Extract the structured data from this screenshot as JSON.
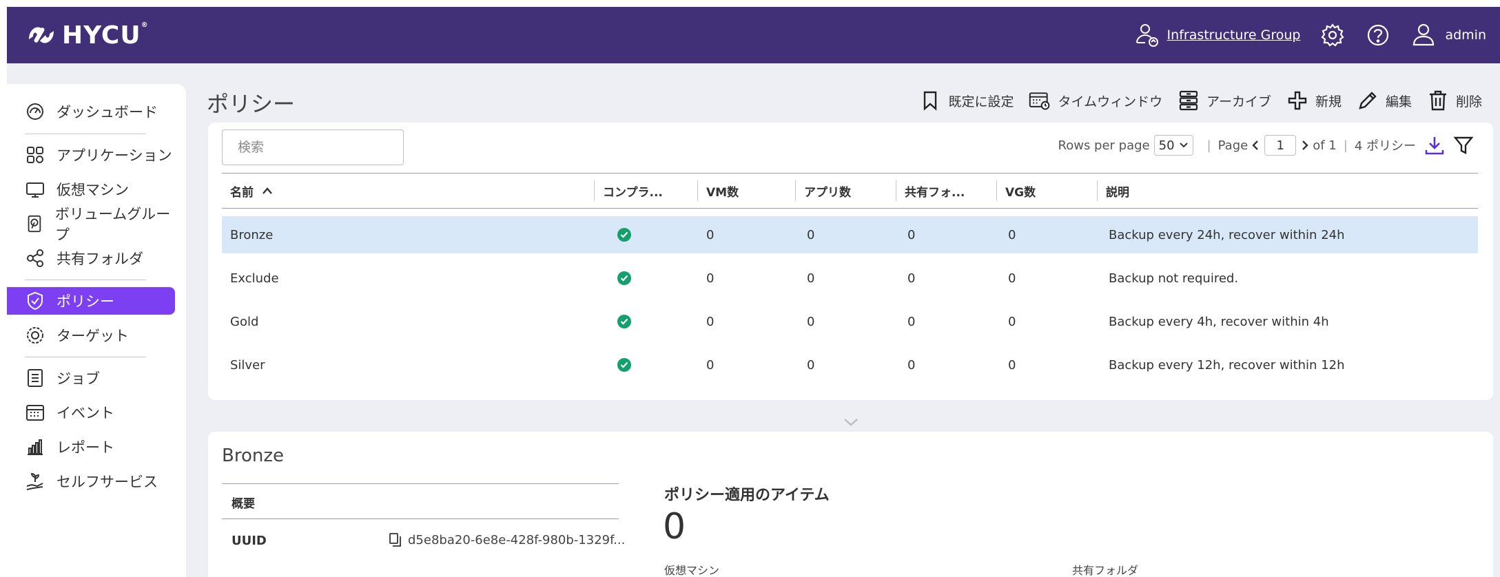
{
  "header": {
    "brand": "HYCU",
    "group_link": "Infrastructure Group",
    "user": "admin",
    "accent_color": "#413078"
  },
  "sidebar": {
    "items": [
      {
        "label": "ダッシュボード",
        "icon": "dashboard-gauge-icon"
      },
      {
        "label": "アプリケーション",
        "icon": "grid-apps-icon"
      },
      {
        "label": "仮想マシン",
        "icon": "monitor-icon"
      },
      {
        "label": "ボリュームグループ",
        "icon": "disk-icon"
      },
      {
        "label": "共有フォルダ",
        "icon": "share-icon"
      },
      {
        "label": "ポリシー",
        "icon": "shield-check-icon",
        "active": true
      },
      {
        "label": "ターゲット",
        "icon": "target-icon"
      },
      {
        "label": "ジョブ",
        "icon": "list-icon"
      },
      {
        "label": "イベント",
        "icon": "calendar-icon"
      },
      {
        "label": "レポート",
        "icon": "bar-chart-icon"
      },
      {
        "label": "セルフサービス",
        "icon": "hand-plant-icon"
      }
    ],
    "active_color": "#7c3ff2"
  },
  "page": {
    "title": "ポリシー"
  },
  "toolbar": {
    "set_default": "既定に設定",
    "time_window": "タイムウィンドウ",
    "archive": "アーカイブ",
    "new": "新規",
    "edit": "編集",
    "delete": "削除"
  },
  "table": {
    "search_placeholder": "検索",
    "rows_per_page_label": "Rows per page",
    "rows_per_page": "50",
    "page_label": "Page",
    "page_current": "1",
    "page_of": "of 1",
    "total": "4 ポリシー",
    "columns": [
      "名前",
      "コンプラ...",
      "VM数",
      "アプリ数",
      "共有フォ...",
      "VG数",
      "説明"
    ],
    "rows": [
      {
        "name": "Bronze",
        "compliant": true,
        "vm": "0",
        "apps": "0",
        "shares": "0",
        "vg": "0",
        "description": "Backup every 24h, recover within 24h",
        "selected": true
      },
      {
        "name": "Exclude",
        "compliant": true,
        "vm": "0",
        "apps": "0",
        "shares": "0",
        "vg": "0",
        "description": "Backup not required."
      },
      {
        "name": "Gold",
        "compliant": true,
        "vm": "0",
        "apps": "0",
        "shares": "0",
        "vg": "0",
        "description": "Backup every 4h, recover within 4h"
      },
      {
        "name": "Silver",
        "compliant": true,
        "vm": "0",
        "apps": "0",
        "shares": "0",
        "vg": "0",
        "description": "Backup every 12h, recover within 12h"
      }
    ],
    "selected_row_color": "#d8e8f8",
    "compliant_color": "#14a06c"
  },
  "detail": {
    "title": "Bronze",
    "summary_label": "概要",
    "uuid_label": "UUID",
    "uuid_value": "d5e8ba20-6e8e-428f-980b-1329f...",
    "items_heading": "ポリシー適用のアイテム",
    "items_count": "0",
    "vm_label": "仮想マシン",
    "share_label": "共有フォルダ"
  }
}
